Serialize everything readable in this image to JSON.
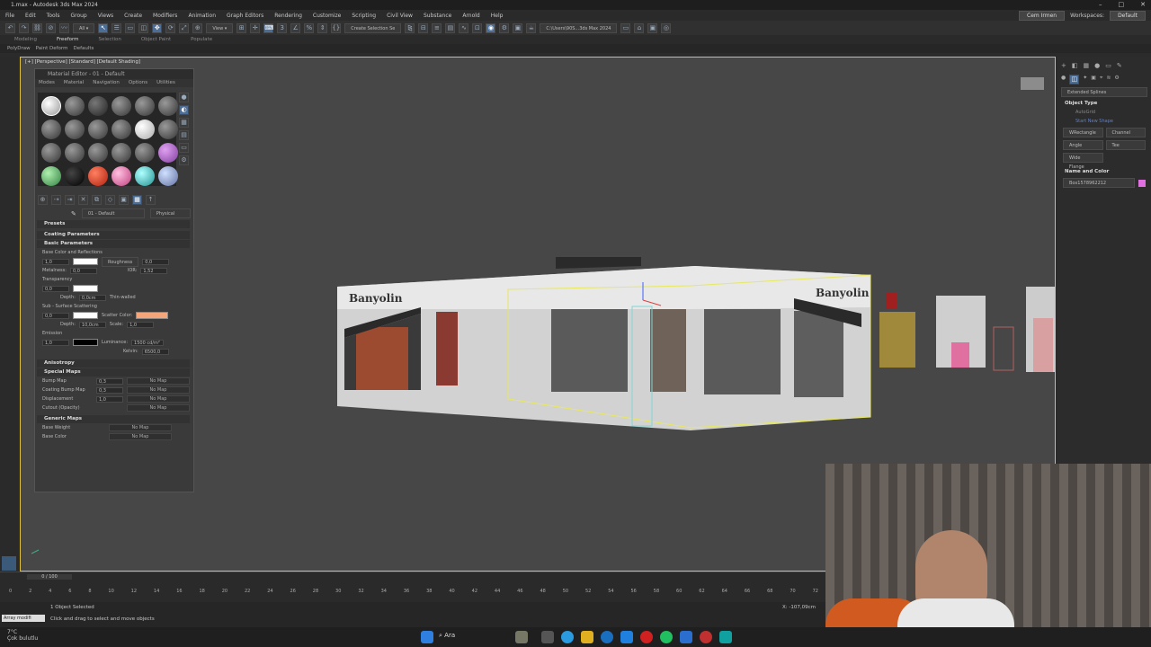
{
  "title": "1.max - Autodesk 3ds Max 2024",
  "menu": [
    "File",
    "Edit",
    "Tools",
    "Group",
    "Views",
    "Create",
    "Modifiers",
    "Animation",
    "Graph Editors",
    "Rendering",
    "Customize",
    "Scripting",
    "Civil View",
    "Substance",
    "Arnold",
    "Help"
  ],
  "user": "Cem Irmen",
  "workspaces_label": "Workspaces:",
  "workspace": "Default",
  "toolbar": {
    "selection_set": "Create Selection Se",
    "path": "C:\\Users\\90S...3ds Max 2024"
  },
  "ribbon": [
    "Modeling",
    "Freeform",
    "Selection",
    "Object Paint",
    "Populate"
  ],
  "ribbon2": [
    "PolyDraw",
    "Paint Deform",
    "Defaults"
  ],
  "viewport_label": "[+] [Perspective] [Standard] [Default Shading]",
  "scene_sign_left": "Banyolin",
  "scene_sign_right": "Banyolin",
  "material_editor": {
    "title": "Material Editor - 01 - Default",
    "menu": [
      "Modes",
      "Material",
      "Navigation",
      "Options",
      "Utilities"
    ],
    "material_name": "01 - Default",
    "material_type": "Physical Material",
    "presets": "Presets",
    "coating": "Coating Parameters",
    "basic": "Basic Parameters",
    "base_color_label": "Base Color and Reflections",
    "base_weight": "1,0",
    "roughness_label": "Roughness",
    "roughness": "0,0",
    "metalness_label": "Metalness:",
    "metalness": "0,0",
    "ior_label": "IOR:",
    "ior": "1,52",
    "transparency_label": "Transparency",
    "transparency": "0,0",
    "depth_label": "Depth:",
    "depth": "0,0cm",
    "thin_walled": "Thin-walled",
    "sss_label": "Sub - Surface Scattering",
    "sss_weight": "0,0",
    "scatter_label": "Scatter Color:",
    "sss_depth": "10,0cm",
    "scale_label": "Scale:",
    "scale": "1,0",
    "emission_label": "Emission",
    "emission": "1,0",
    "luminance_label": "Luminance:",
    "luminance": "1500 cd/m²",
    "kelvin_label": "Kelvin:",
    "kelvin": "6500,0",
    "anisotropy": "Anisotropy",
    "special_maps": "Special Maps",
    "maps": [
      {
        "name": "Bump Map",
        "value": "0,3",
        "map": "No Map"
      },
      {
        "name": "Coating Bump Map",
        "value": "0,3",
        "map": "No Map"
      },
      {
        "name": "Displacement",
        "value": "1,0",
        "map": "No Map"
      },
      {
        "name": "Cutout (Opacity)",
        "value": "",
        "map": "No Map"
      }
    ],
    "generic_maps": "Generic Maps",
    "generic": [
      {
        "name": "Base Weight",
        "map": "No Map"
      },
      {
        "name": "Base Color",
        "map": "No Map"
      }
    ]
  },
  "command_panel": {
    "dropdown": "Extended Splines",
    "object_type": "Object Type",
    "autogrid": "AutoGrid",
    "start_new": "Start New Shape",
    "buttons": [
      "WRectangle",
      "Channel",
      "Angle",
      "Tee",
      "Wide Flange"
    ],
    "name_color": "Name and Color",
    "name": "Box1578962212"
  },
  "timeline": {
    "frame": "0 / 100",
    "ticks": [
      "0",
      "2",
      "4",
      "6",
      "8",
      "10",
      "12",
      "14",
      "16",
      "18",
      "20",
      "22",
      "24",
      "26",
      "28",
      "30",
      "32",
      "34",
      "36",
      "38",
      "40",
      "42",
      "44",
      "46",
      "48",
      "50",
      "52",
      "54",
      "56",
      "58",
      "60",
      "62",
      "64",
      "66",
      "68",
      "70",
      "72"
    ]
  },
  "status": {
    "selected": "1 Object Selected",
    "hint": "Click and drag to select and move objects",
    "maxscript": "Array modifi",
    "coord": "X: -107,09cm"
  },
  "weather": {
    "temp": "7°C",
    "desc": "Çok bulutlu"
  },
  "taskbar": {
    "search": "Ara"
  },
  "colors": {
    "accent": "#4b6d96",
    "scatter": "#f4a57a",
    "viewport_border": "#e0c040"
  }
}
